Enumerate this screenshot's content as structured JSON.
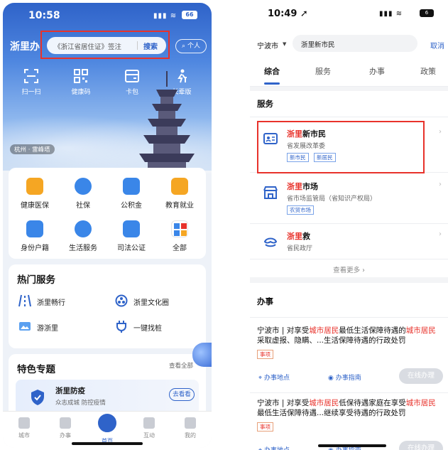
{
  "left": {
    "status": {
      "time": "10:58",
      "battery": "66"
    },
    "brand": "浙里办",
    "search": {
      "placeholder": "《浙江省居住证》签注",
      "button": "搜索"
    },
    "personal_button": "个人",
    "quick_actions": [
      {
        "label": "扫一扫",
        "icon": "scan-icon"
      },
      {
        "label": "健康码",
        "icon": "qr-code-icon"
      },
      {
        "label": "卡包",
        "icon": "card-wallet-icon"
      },
      {
        "label": "长辈版",
        "icon": "elder-mode-icon"
      }
    ],
    "location_tag": "杭州 · 雷峰塔",
    "services": [
      {
        "label": "健康医保",
        "icon": "medical-kit-icon",
        "color": "#f5a623"
      },
      {
        "label": "社保",
        "icon": "shield-icon",
        "color": "#3a86e8"
      },
      {
        "label": "公积金",
        "icon": "house-icon",
        "color": "#3a86e8"
      },
      {
        "label": "教育就业",
        "icon": "education-icon",
        "color": "#f5a623"
      },
      {
        "label": "身份户籍",
        "icon": "id-card-icon",
        "color": "#3a86e8"
      },
      {
        "label": "生活服务",
        "icon": "lightning-icon",
        "color": "#3a86e8"
      },
      {
        "label": "司法公证",
        "icon": "notary-icon",
        "color": "#3a86e8"
      },
      {
        "label": "全部",
        "icon": "grid-icon",
        "color": "#3a86e8"
      }
    ],
    "hot": {
      "title": "热门服务",
      "items": [
        {
          "label": "浙里畅行",
          "icon": "road-icon"
        },
        {
          "label": "浙里文化圈",
          "icon": "culture-icon"
        },
        {
          "label": "游浙里",
          "icon": "travel-icon"
        },
        {
          "label": "一键找桩",
          "icon": "charging-pile-icon"
        }
      ]
    },
    "topic": {
      "title": "特色专题",
      "all": "查看全部",
      "card_title": "浙里防疫",
      "card_sub": "众志成城 防控疫情",
      "card_button": "去看看"
    },
    "tabbar": [
      {
        "label": "城市",
        "icon": "city-icon"
      },
      {
        "label": "办事",
        "icon": "affairs-icon"
      },
      {
        "label": "首页",
        "icon": "home-icon"
      },
      {
        "label": "互动",
        "icon": "interact-icon"
      },
      {
        "label": "我的",
        "icon": "profile-icon"
      }
    ]
  },
  "right": {
    "status": {
      "time": "10:49",
      "battery": "6"
    },
    "city": "宁波市",
    "search_value": "浙里新市民",
    "cancel": "取消",
    "tabs": [
      "综合",
      "服务",
      "办事",
      "政策"
    ],
    "services_title": "服务",
    "services": [
      {
        "name_hl": "浙里",
        "name_rest": "新市民",
        "dept": "省发展改革委",
        "tags": [
          "新市民",
          "新居民"
        ],
        "icon": "person-card-icon"
      },
      {
        "name_hl": "浙里",
        "name_rest": "市场",
        "dept": "省市场监管局（省知识产权局）",
        "tags": [
          "农贸市场"
        ],
        "icon": "market-icon"
      },
      {
        "name_hl": "浙里",
        "name_rest": "救",
        "dept": "省民政厅",
        "tags": [],
        "icon": "rescue-icon"
      }
    ],
    "more": "查看更多 ›",
    "affairs_title": "办事",
    "affairs": [
      {
        "prefix": "宁波市 | 对享受",
        "hl1": "城市居民",
        "mid": "最低生活保障待遇的",
        "hl2": "城市居民",
        "suffix": "采取虚报、隐瞒、...生活保障待遇的行政处罚",
        "tag": "事项"
      },
      {
        "prefix": "宁波市 | 对享受",
        "hl1": "城市居民",
        "mid": "低保待遇家庭在享受",
        "hl2": "城市居民",
        "suffix": "最低生活保障待遇...继续享受待遇的行政处罚",
        "tag": "事项"
      }
    ],
    "actions": {
      "place": "办事地点",
      "guide": "办事指南",
      "online": "在线办理"
    }
  }
}
